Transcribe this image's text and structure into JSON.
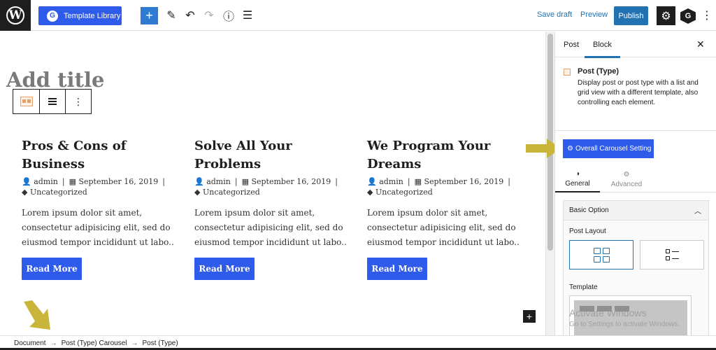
{
  "topbar": {
    "template_library": "Template Library",
    "save_draft": "Save draft",
    "preview": "Preview",
    "publish": "Publish"
  },
  "editor": {
    "title_placeholder": "Add title",
    "posts": [
      {
        "title": "Pros & Cons of Business",
        "author": "admin",
        "date": "September 16, 2019",
        "category": "Uncategorized",
        "excerpt": "Lorem ipsum dolor sit amet, consectetur adipisicing elit, sed do eiusmod tempor incididunt ut labo..",
        "read_more": "Read More"
      },
      {
        "title": "Solve All Your Problems",
        "author": "admin",
        "date": "September 16, 2019",
        "category": "Uncategorized",
        "excerpt": "Lorem ipsum dolor sit amet, consectetur adipisicing elit, sed do eiusmod tempor incididunt ut labo..",
        "read_more": "Read More"
      },
      {
        "title": "We Program Your Dreams",
        "author": "admin",
        "date": "September 16, 2019",
        "category": "Uncategorized",
        "excerpt": "Lorem ipsum dolor sit amet, consectetur adipisicing elit, sed do eiusmod tempor incididunt ut labo..",
        "read_more": "Read More"
      }
    ]
  },
  "sidebar": {
    "tab_post": "Post",
    "tab_block": "Block",
    "block_title": "Post (Type)",
    "block_desc": "Display post or post type with a list and grid view with a different template, also controlling each element.",
    "carousel_setting": "Overall Carousel Setting",
    "tab_general": "General",
    "tab_advanced": "Advanced",
    "basic_option": "Basic Option",
    "post_layout": "Post Layout",
    "template": "Template"
  },
  "watermark": {
    "title": "Activate Windows",
    "subtitle": "Go to Settings to activate Windows."
  },
  "breadcrumb": [
    "Document",
    "Post (Type) Carousel",
    "Post (Type)"
  ],
  "colors": {
    "accent_blue": "#2f5bea",
    "wp_blue": "#2271b1",
    "arrow_yellow": "#c9b53a"
  }
}
